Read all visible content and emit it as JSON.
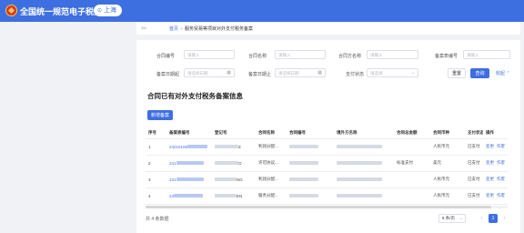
{
  "header": {
    "app_title": "全国统一规范电子税务局",
    "region": "上海",
    "pin_icon": "location-pin-icon",
    "brand_color": "#3e6fe0"
  },
  "breadcrumb": {
    "home": "首页",
    "separator": ">",
    "current": "服务贸易等项目对外支付税务备案"
  },
  "filters": {
    "contract_no": {
      "label": "合同编号",
      "placeholder": "请输入"
    },
    "contract_name": {
      "label": "合同名称",
      "placeholder": "请输入"
    },
    "party_name": {
      "label": "合同方名称",
      "placeholder": "请输入"
    },
    "filing_no": {
      "label": "备案表编号",
      "placeholder": "请输入"
    },
    "filing_start": {
      "label": "备案日期起",
      "placeholder": "请选择日期"
    },
    "filing_end": {
      "label": "备案日期止",
      "placeholder": "请选择日期"
    },
    "pay_status": {
      "label": "支付状态",
      "placeholder": "请选择"
    }
  },
  "actions": {
    "reset": "重置",
    "query": "查询",
    "collapse": "收起"
  },
  "section_title": "合同已有对外支付税务备案信息",
  "add_button": "新增备案",
  "table": {
    "columns": [
      "序号",
      "备案表编号",
      "登记号",
      "合同名称",
      "合同编号",
      "境外方名称",
      "合同总金额",
      "合同币种",
      "支付状态",
      "操作"
    ],
    "rows": [
      {
        "seq": "1",
        "filing_no": "24210105",
        "reg_tail": "Z",
        "contract_name": "利润分配...",
        "currency": "人民币元",
        "amount": "",
        "status": "已支付",
        "ops": [
          "变更",
          "作废"
        ]
      },
      {
        "seq": "2",
        "filing_no": "241",
        "reg_tail": "O",
        "contract_name": "许可协议...",
        "currency": "美元",
        "amount": "标准支付",
        "status": "已支付",
        "ops": [
          "变更",
          "作废"
        ]
      },
      {
        "seq": "3",
        "filing_no": "231",
        "reg_tail": "NG",
        "contract_name": "利润分配...",
        "currency": "人民币元",
        "amount": "",
        "status": "已支付",
        "ops": [
          "变更",
          "作废"
        ]
      },
      {
        "seq": "4",
        "filing_no": "23",
        "reg_tail": "EN",
        "contract_name": "服务分配...",
        "currency": "人民币元",
        "amount": "",
        "status": "已支付",
        "ops": [
          "变更",
          "作废"
        ]
      }
    ]
  },
  "pagination": {
    "total": "共 4 条数据",
    "page_size": "5 条/页",
    "current_page": "1",
    "prev": "‹",
    "next": "›"
  }
}
